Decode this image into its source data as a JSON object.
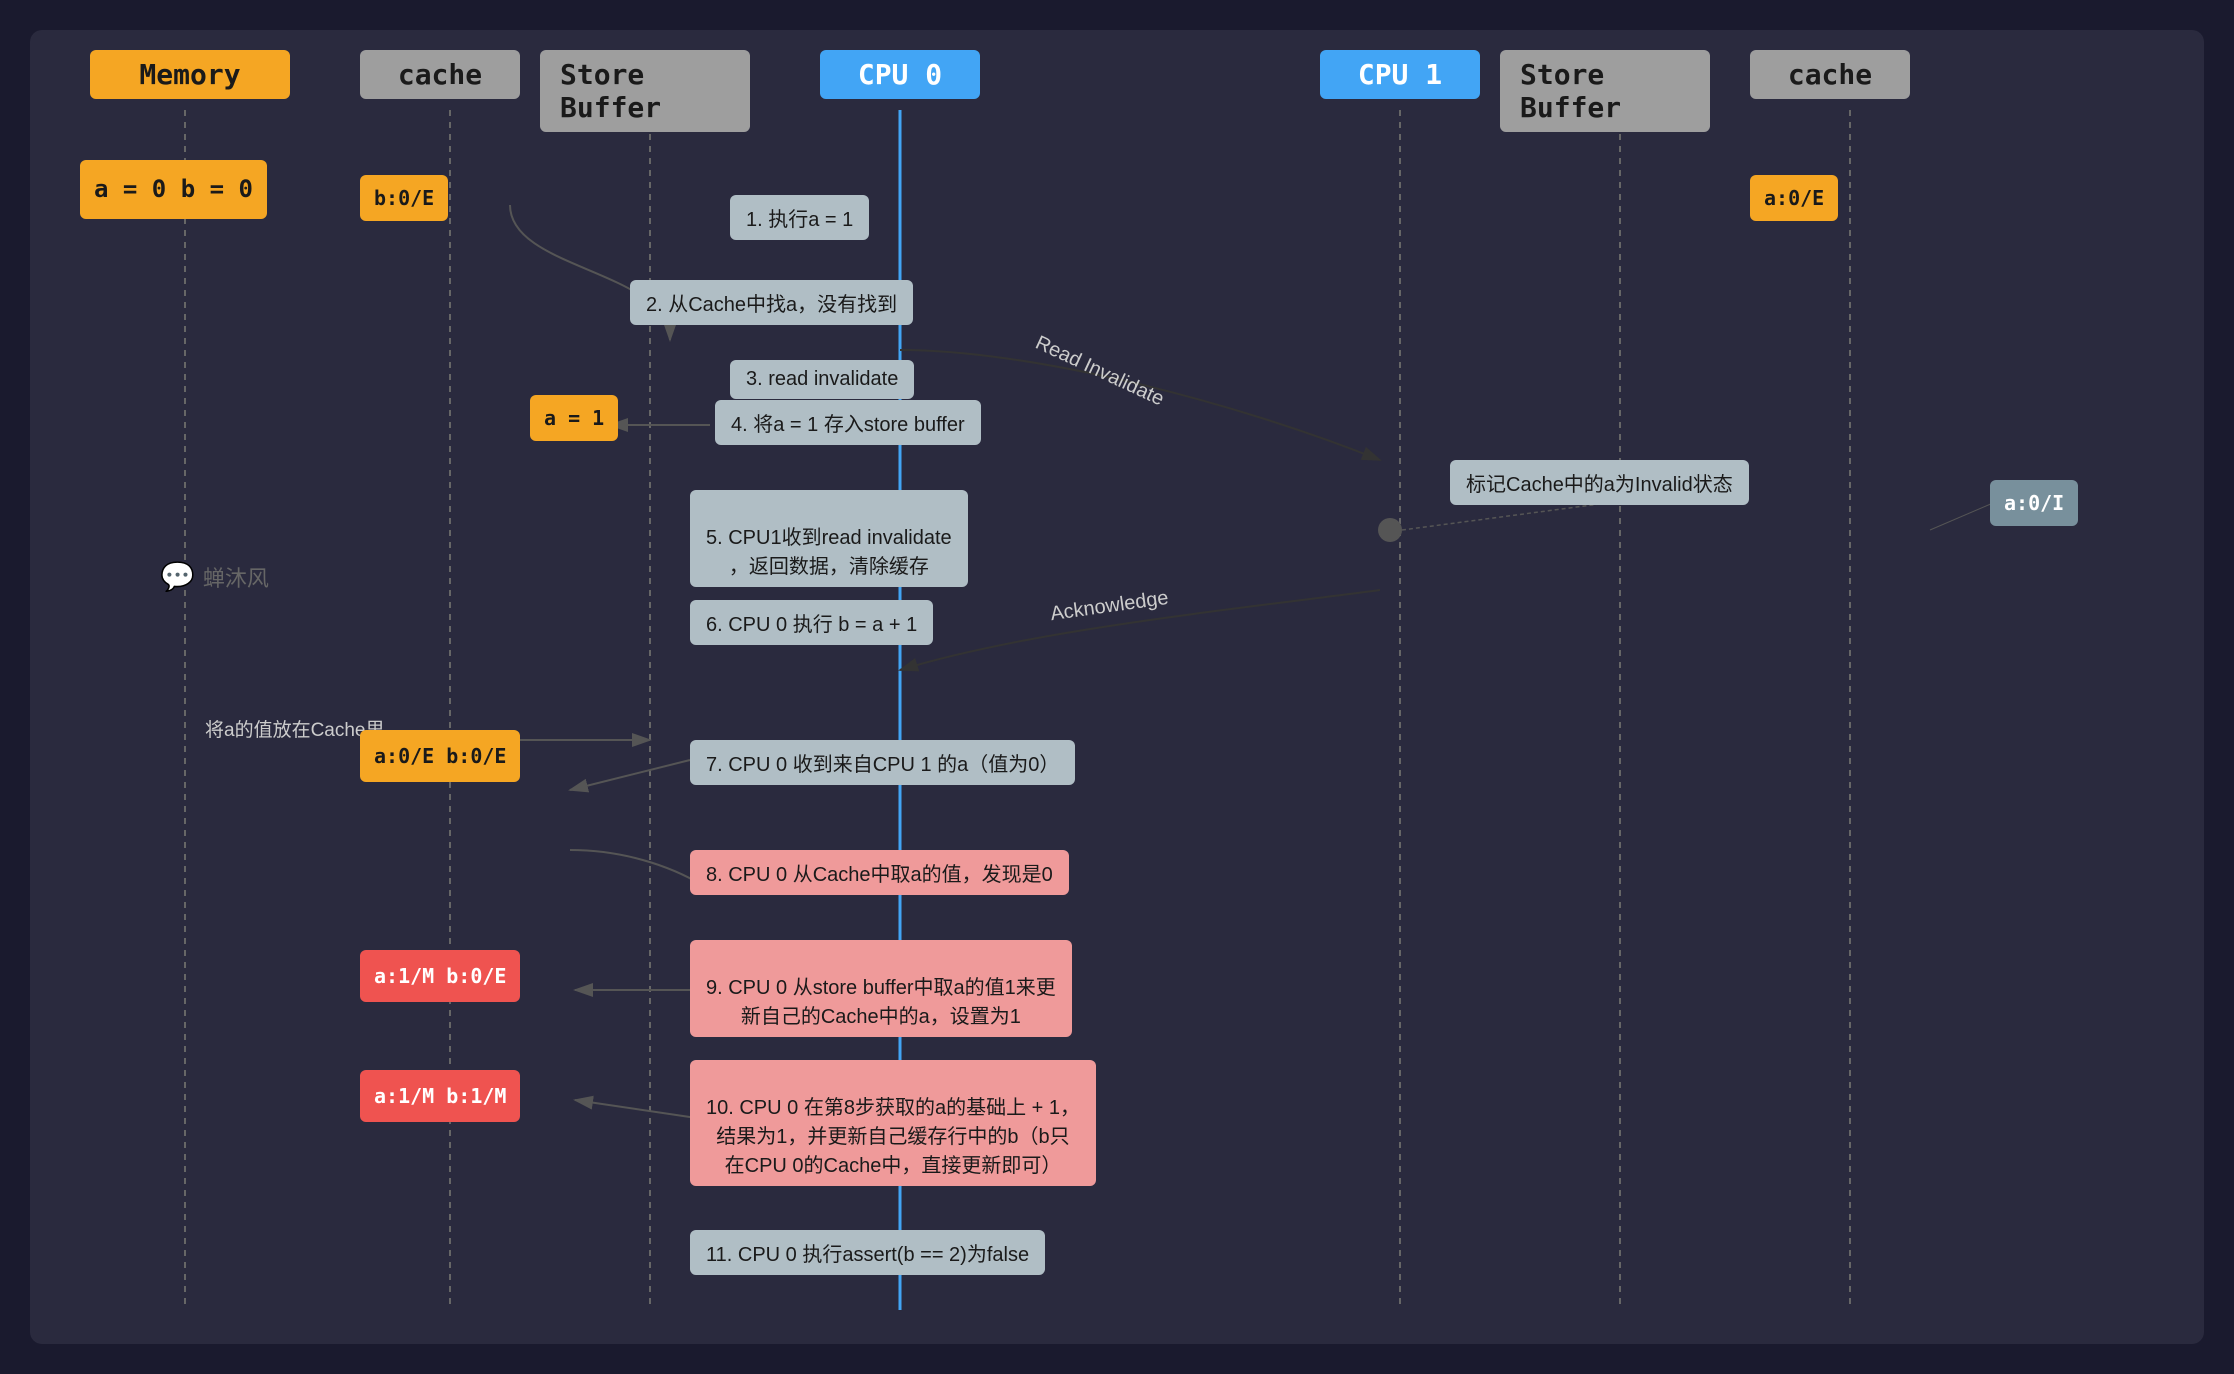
{
  "header": {
    "memory_label": "Memory",
    "cache_left_label": "cache",
    "store_buffer_left_label": "Store Buffer",
    "cpu0_label": "CPU 0",
    "cpu1_label": "CPU 1",
    "store_buffer_right_label": "Store Buffer",
    "cache_right_label": "cache"
  },
  "memory_values": "a = 0\nb = 0",
  "cache_left_initial": "b:0/E",
  "cache_right_initial": "a:0/E",
  "cache_right_invalid": "a:0/I",
  "cache_left_state1": "a:0/E\nb:0/E",
  "cache_left_state2": "a:1/M\nb:0/E",
  "cache_left_state3": "a:1/M\nb:1/M",
  "store_buffer_a1": "a = 1",
  "steps": [
    {
      "id": 1,
      "text": "1. 执行a = 1"
    },
    {
      "id": 2,
      "text": "2. 从Cache中找a，没有找到"
    },
    {
      "id": 3,
      "text": "3. read invalidate"
    },
    {
      "id": 4,
      "text": "4. 将a = 1 存入store buffer"
    },
    {
      "id": 5,
      "text": "5. CPU1收到read invalidate\n，返回数据，清除缓存"
    },
    {
      "id": 6,
      "text": "6. CPU 0 执行 b = a + 1"
    },
    {
      "id": 7,
      "text": "7. CPU 0 收到来自CPU 1 的a（值为0）"
    },
    {
      "id": 8,
      "text": "8. CPU 0 从Cache中取a的值，发现是0"
    },
    {
      "id": 9,
      "text": "9. CPU 0 从store buffer中取a的值1来更\n新自己的Cache中的a，设置为1"
    },
    {
      "id": 10,
      "text": "10. CPU 0 在第8步获取的a的基础上 + 1，\n结果为1，并更新自己缓存行中的b（b只\n在CPU 0的Cache中，直接更新即可）"
    },
    {
      "id": 11,
      "text": "11. CPU 0 执行assert(b == 2)为false"
    }
  ],
  "annotations": {
    "read_invalidate": "Read Invalidate",
    "acknowledge": "Acknowledge",
    "mark_invalid": "标记Cache中的a为Invalid状态",
    "put_a_in_cache": "将a的值放在Cache里"
  },
  "watermark": "蝉沐风"
}
